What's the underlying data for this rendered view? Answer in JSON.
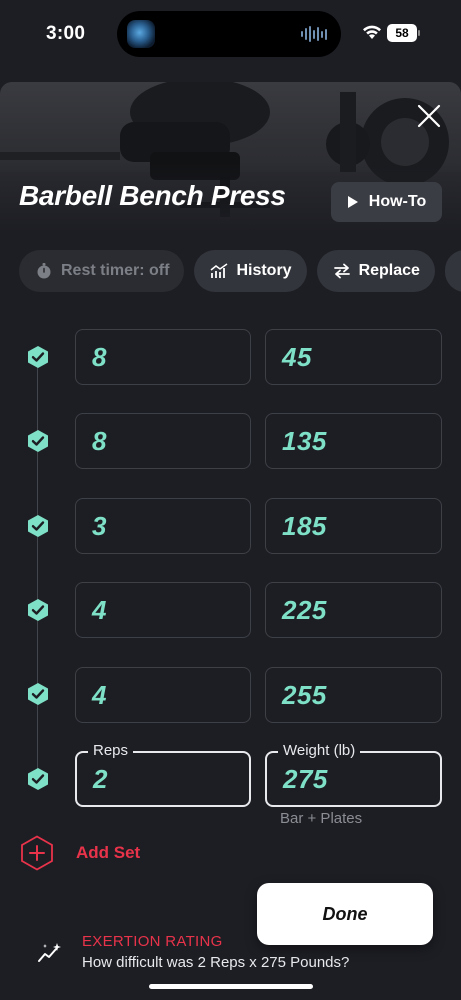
{
  "status_bar": {
    "time": "3:00",
    "battery": "58"
  },
  "exercise": {
    "title": "Barbell Bench Press",
    "howto_label": "How-To"
  },
  "chips": [
    {
      "label": "Rest timer: off",
      "icon": "stopwatch-icon"
    },
    {
      "label": "History",
      "icon": "chart-icon"
    },
    {
      "label": "Replace",
      "icon": "swap-icon"
    }
  ],
  "sets": [
    {
      "reps": "8",
      "weight": "45"
    },
    {
      "reps": "8",
      "weight": "135"
    },
    {
      "reps": "3",
      "weight": "185"
    },
    {
      "reps": "4",
      "weight": "225"
    },
    {
      "reps": "4",
      "weight": "255"
    },
    {
      "reps": "2",
      "weight": "275"
    }
  ],
  "active_set": {
    "reps_label": "Reps",
    "weight_label": "Weight (lb)",
    "helper": "Bar + Plates"
  },
  "add_set_label": "Add Set",
  "done_label": "Done",
  "exertion": {
    "title": "EXERTION RATING",
    "subtitle": "How difficult was 2 Reps x 275 Pounds?"
  },
  "colors": {
    "accent_green": "#7ee0c6",
    "accent_red": "#e8334a",
    "background": "#1d1e24"
  }
}
